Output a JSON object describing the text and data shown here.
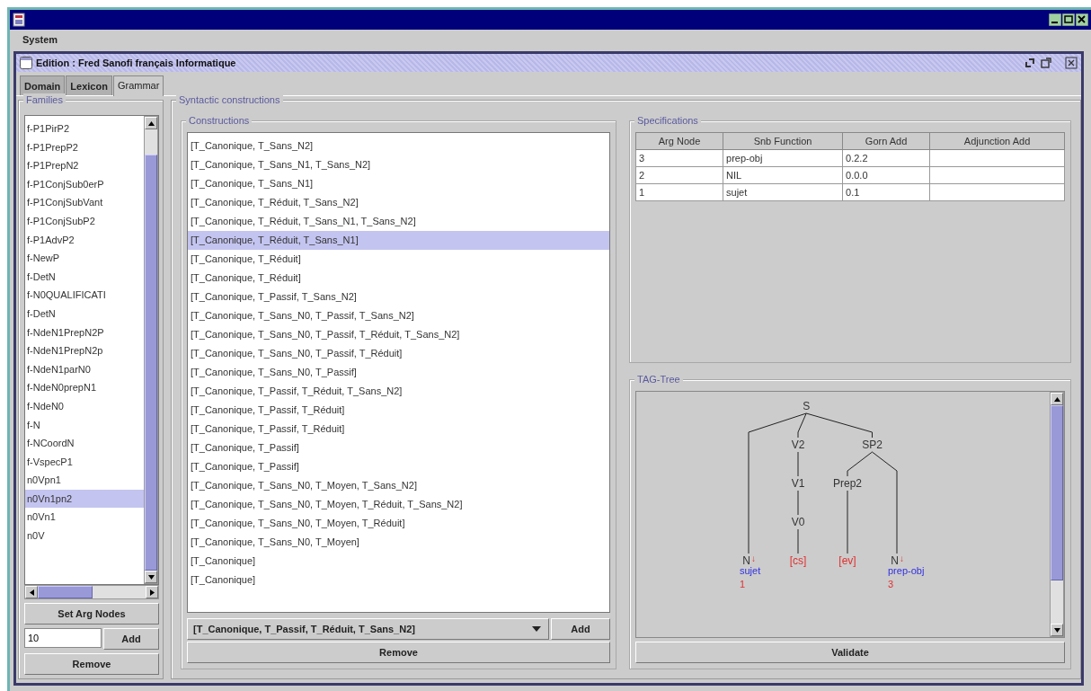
{
  "menu": [
    "System"
  ],
  "frame": {
    "title": "Edition : Fred Sanofi français Informatique"
  },
  "tabs": [
    {
      "label": "Domain",
      "selected": false
    },
    {
      "label": "Lexicon",
      "selected": false
    },
    {
      "label": "Grammar",
      "selected": true
    }
  ],
  "families": {
    "title": "Families",
    "items": [
      {
        "label": "f-P1PirP2",
        "selected": false
      },
      {
        "label": "f-P1PrepP2",
        "selected": false
      },
      {
        "label": "f-P1PrepN2",
        "selected": false
      },
      {
        "label": "f-P1ConjSub0erP",
        "selected": false
      },
      {
        "label": "f-P1ConjSubVant",
        "selected": false
      },
      {
        "label": "f-P1ConjSubP2",
        "selected": false
      },
      {
        "label": "f-P1AdvP2",
        "selected": false
      },
      {
        "label": "f-NewP",
        "selected": false
      },
      {
        "label": "f-DetN",
        "selected": false
      },
      {
        "label": "f-N0QUALIFICATI",
        "selected": false
      },
      {
        "label": "f-DetN",
        "selected": false
      },
      {
        "label": "f-NdeN1PrepN2P",
        "selected": false
      },
      {
        "label": "f-NdeN1PrepN2p",
        "selected": false
      },
      {
        "label": "f-NdeN1parN0",
        "selected": false
      },
      {
        "label": "f-NdeN0prepN1",
        "selected": false
      },
      {
        "label": "f-NdeN0",
        "selected": false
      },
      {
        "label": "f-N",
        "selected": false
      },
      {
        "label": "f-NCoordN",
        "selected": false
      },
      {
        "label": "f-VspecP1",
        "selected": false
      },
      {
        "label": "n0Vpn1",
        "selected": false
      },
      {
        "label": "n0Vn1pn2",
        "selected": true
      },
      {
        "label": "n0Vn1",
        "selected": false
      },
      {
        "label": "n0V",
        "selected": false
      }
    ],
    "set_button": "Set Arg Nodes",
    "field_value": "10",
    "add_button": "Add",
    "remove_button": "Remove"
  },
  "syntactic": {
    "title": "Syntactic constructions"
  },
  "constructions": {
    "title": "Constructions",
    "items": [
      {
        "label": "[T_Canonique, T_Sans_N2]",
        "selected": false
      },
      {
        "label": "[T_Canonique, T_Sans_N1, T_Sans_N2]",
        "selected": false
      },
      {
        "label": "[T_Canonique, T_Sans_N1]",
        "selected": false
      },
      {
        "label": "[T_Canonique, T_Réduit, T_Sans_N2]",
        "selected": false
      },
      {
        "label": "[T_Canonique, T_Réduit, T_Sans_N1, T_Sans_N2]",
        "selected": false
      },
      {
        "label": "[T_Canonique, T_Réduit, T_Sans_N1]",
        "selected": true
      },
      {
        "label": "[T_Canonique, T_Réduit]",
        "selected": false
      },
      {
        "label": "[T_Canonique, T_Réduit]",
        "selected": false
      },
      {
        "label": "[T_Canonique, T_Passif, T_Sans_N2]",
        "selected": false
      },
      {
        "label": "[T_Canonique, T_Sans_N0, T_Passif, T_Sans_N2]",
        "selected": false
      },
      {
        "label": "[T_Canonique, T_Sans_N0, T_Passif, T_Réduit, T_Sans_N2]",
        "selected": false
      },
      {
        "label": "[T_Canonique, T_Sans_N0, T_Passif, T_Réduit]",
        "selected": false
      },
      {
        "label": "[T_Canonique, T_Sans_N0, T_Passif]",
        "selected": false
      },
      {
        "label": "[T_Canonique, T_Passif, T_Réduit, T_Sans_N2]",
        "selected": false
      },
      {
        "label": "[T_Canonique, T_Passif, T_Réduit]",
        "selected": false
      },
      {
        "label": "[T_Canonique, T_Passif, T_Réduit]",
        "selected": false
      },
      {
        "label": "[T_Canonique, T_Passif]",
        "selected": false
      },
      {
        "label": "[T_Canonique, T_Passif]",
        "selected": false
      },
      {
        "label": "[T_Canonique, T_Sans_N0, T_Moyen, T_Sans_N2]",
        "selected": false
      },
      {
        "label": "[T_Canonique, T_Sans_N0, T_Moyen, T_Réduit, T_Sans_N2]",
        "selected": false
      },
      {
        "label": "[T_Canonique, T_Sans_N0, T_Moyen, T_Réduit]",
        "selected": false
      },
      {
        "label": "[T_Canonique, T_Sans_N0, T_Moyen]",
        "selected": false
      },
      {
        "label": "[T_Canonique]",
        "selected": false
      },
      {
        "label": "[T_Canonique]",
        "selected": false
      }
    ],
    "combo_value": "[T_Canonique, T_Passif, T_Réduit, T_Sans_N2]",
    "add_button": "Add",
    "remove_button": "Remove"
  },
  "specifications": {
    "title": "Specifications",
    "columns": [
      "Arg Node",
      "Snb Function",
      "Gorn Add",
      "Adjunction Add"
    ],
    "rows": [
      [
        "3",
        "prep-obj",
        "0.2.2",
        ""
      ],
      [
        "2",
        "NIL",
        "0.0.0",
        ""
      ],
      [
        "1",
        "sujet",
        "0.1",
        ""
      ]
    ]
  },
  "tag_tree": {
    "title": "TAG-Tree",
    "validate_button": "Validate",
    "root": {
      "kind": "node",
      "label": "S",
      "children": [
        {
          "kind": "subst",
          "label": "N",
          "mark": "↓",
          "function": "sujet",
          "arg": "1"
        },
        {
          "kind": "node",
          "label": "V2",
          "children": [
            {
              "kind": "node",
              "label": "V1",
              "children": [
                {
                  "kind": "node",
                  "label": "V0",
                  "children": [
                    {
                      "kind": "anchor",
                      "label": "[cs]"
                    }
                  ]
                }
              ]
            }
          ]
        },
        {
          "kind": "node",
          "label": "SP2",
          "children": [
            {
              "kind": "node",
              "label": "Prep2",
              "children": [
                {
                  "kind": "anchor",
                  "label": "[ev]"
                }
              ]
            },
            {
              "kind": "subst",
              "label": "N",
              "mark": "↓",
              "function": "prep-obj",
              "arg": "3"
            }
          ]
        }
      ]
    }
  }
}
